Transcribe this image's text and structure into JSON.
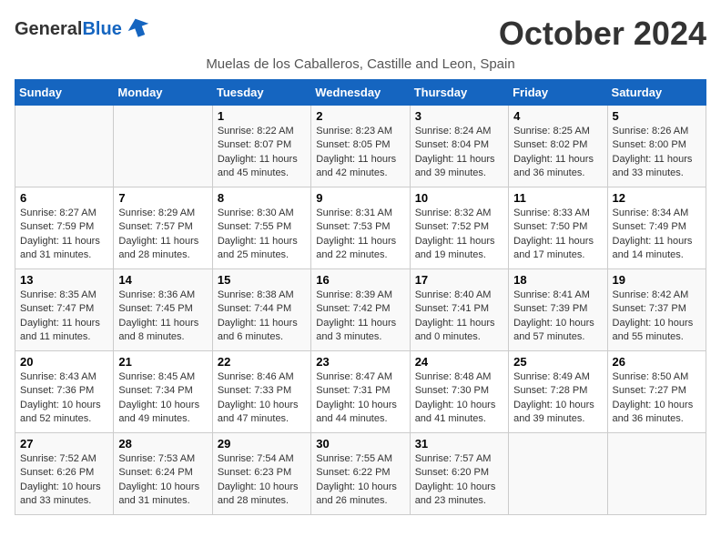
{
  "header": {
    "logo_general": "General",
    "logo_blue": "Blue",
    "month_title": "October 2024",
    "subtitle": "Muelas de los Caballeros, Castille and Leon, Spain"
  },
  "weekdays": [
    "Sunday",
    "Monday",
    "Tuesday",
    "Wednesday",
    "Thursday",
    "Friday",
    "Saturday"
  ],
  "weeks": [
    [
      {
        "day": "",
        "info": ""
      },
      {
        "day": "",
        "info": ""
      },
      {
        "day": "1",
        "info": "Sunrise: 8:22 AM\nSunset: 8:07 PM\nDaylight: 11 hours and 45 minutes."
      },
      {
        "day": "2",
        "info": "Sunrise: 8:23 AM\nSunset: 8:05 PM\nDaylight: 11 hours and 42 minutes."
      },
      {
        "day": "3",
        "info": "Sunrise: 8:24 AM\nSunset: 8:04 PM\nDaylight: 11 hours and 39 minutes."
      },
      {
        "day": "4",
        "info": "Sunrise: 8:25 AM\nSunset: 8:02 PM\nDaylight: 11 hours and 36 minutes."
      },
      {
        "day": "5",
        "info": "Sunrise: 8:26 AM\nSunset: 8:00 PM\nDaylight: 11 hours and 33 minutes."
      }
    ],
    [
      {
        "day": "6",
        "info": "Sunrise: 8:27 AM\nSunset: 7:59 PM\nDaylight: 11 hours and 31 minutes."
      },
      {
        "day": "7",
        "info": "Sunrise: 8:29 AM\nSunset: 7:57 PM\nDaylight: 11 hours and 28 minutes."
      },
      {
        "day": "8",
        "info": "Sunrise: 8:30 AM\nSunset: 7:55 PM\nDaylight: 11 hours and 25 minutes."
      },
      {
        "day": "9",
        "info": "Sunrise: 8:31 AM\nSunset: 7:53 PM\nDaylight: 11 hours and 22 minutes."
      },
      {
        "day": "10",
        "info": "Sunrise: 8:32 AM\nSunset: 7:52 PM\nDaylight: 11 hours and 19 minutes."
      },
      {
        "day": "11",
        "info": "Sunrise: 8:33 AM\nSunset: 7:50 PM\nDaylight: 11 hours and 17 minutes."
      },
      {
        "day": "12",
        "info": "Sunrise: 8:34 AM\nSunset: 7:49 PM\nDaylight: 11 hours and 14 minutes."
      }
    ],
    [
      {
        "day": "13",
        "info": "Sunrise: 8:35 AM\nSunset: 7:47 PM\nDaylight: 11 hours and 11 minutes."
      },
      {
        "day": "14",
        "info": "Sunrise: 8:36 AM\nSunset: 7:45 PM\nDaylight: 11 hours and 8 minutes."
      },
      {
        "day": "15",
        "info": "Sunrise: 8:38 AM\nSunset: 7:44 PM\nDaylight: 11 hours and 6 minutes."
      },
      {
        "day": "16",
        "info": "Sunrise: 8:39 AM\nSunset: 7:42 PM\nDaylight: 11 hours and 3 minutes."
      },
      {
        "day": "17",
        "info": "Sunrise: 8:40 AM\nSunset: 7:41 PM\nDaylight: 11 hours and 0 minutes."
      },
      {
        "day": "18",
        "info": "Sunrise: 8:41 AM\nSunset: 7:39 PM\nDaylight: 10 hours and 57 minutes."
      },
      {
        "day": "19",
        "info": "Sunrise: 8:42 AM\nSunset: 7:37 PM\nDaylight: 10 hours and 55 minutes."
      }
    ],
    [
      {
        "day": "20",
        "info": "Sunrise: 8:43 AM\nSunset: 7:36 PM\nDaylight: 10 hours and 52 minutes."
      },
      {
        "day": "21",
        "info": "Sunrise: 8:45 AM\nSunset: 7:34 PM\nDaylight: 10 hours and 49 minutes."
      },
      {
        "day": "22",
        "info": "Sunrise: 8:46 AM\nSunset: 7:33 PM\nDaylight: 10 hours and 47 minutes."
      },
      {
        "day": "23",
        "info": "Sunrise: 8:47 AM\nSunset: 7:31 PM\nDaylight: 10 hours and 44 minutes."
      },
      {
        "day": "24",
        "info": "Sunrise: 8:48 AM\nSunset: 7:30 PM\nDaylight: 10 hours and 41 minutes."
      },
      {
        "day": "25",
        "info": "Sunrise: 8:49 AM\nSunset: 7:28 PM\nDaylight: 10 hours and 39 minutes."
      },
      {
        "day": "26",
        "info": "Sunrise: 8:50 AM\nSunset: 7:27 PM\nDaylight: 10 hours and 36 minutes."
      }
    ],
    [
      {
        "day": "27",
        "info": "Sunrise: 7:52 AM\nSunset: 6:26 PM\nDaylight: 10 hours and 33 minutes."
      },
      {
        "day": "28",
        "info": "Sunrise: 7:53 AM\nSunset: 6:24 PM\nDaylight: 10 hours and 31 minutes."
      },
      {
        "day": "29",
        "info": "Sunrise: 7:54 AM\nSunset: 6:23 PM\nDaylight: 10 hours and 28 minutes."
      },
      {
        "day": "30",
        "info": "Sunrise: 7:55 AM\nSunset: 6:22 PM\nDaylight: 10 hours and 26 minutes."
      },
      {
        "day": "31",
        "info": "Sunrise: 7:57 AM\nSunset: 6:20 PM\nDaylight: 10 hours and 23 minutes."
      },
      {
        "day": "",
        "info": ""
      },
      {
        "day": "",
        "info": ""
      }
    ]
  ]
}
